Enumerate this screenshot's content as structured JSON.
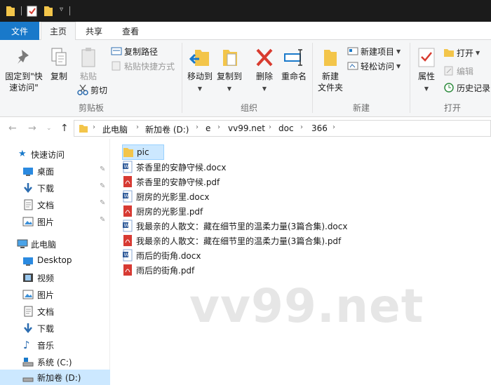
{
  "ribbon_tabs": {
    "file": "文件",
    "home": "主页",
    "share": "共享",
    "view": "查看"
  },
  "clipboard": {
    "pin_quick": "固定到\"快速访问\"",
    "pin_quick_l1": "固定到\"快",
    "pin_quick_l2": "速访问\"",
    "copy": "复制",
    "paste": "粘贴",
    "copy_path": "复制路径",
    "paste_shortcut": "粘贴快捷方式",
    "cut": "剪切",
    "label": "剪贴板"
  },
  "organize": {
    "move_to": "移动到",
    "copy_to": "复制到",
    "delete": "删除",
    "rename": "重命名",
    "label": "组织"
  },
  "new_group": {
    "new_folder_l1": "新建",
    "new_folder_l2": "文件夹",
    "new_item": "新建项目",
    "easy_access": "轻松访问",
    "label": "新建"
  },
  "open_group": {
    "properties": "属性",
    "open": "打开",
    "edit": "编辑",
    "history": "历史记录",
    "label": "打开"
  },
  "breadcrumb": [
    "此电脑",
    "新加卷 (D:)",
    "e",
    "vv99.net",
    "doc",
    "366"
  ],
  "nav_pane": {
    "quick_access": "快速访问",
    "pinned": [
      {
        "label": "桌面",
        "icon": "desktop-icon"
      },
      {
        "label": "下载",
        "icon": "download-icon"
      },
      {
        "label": "文档",
        "icon": "documents-icon"
      },
      {
        "label": "图片",
        "icon": "pictures-icon"
      }
    ],
    "this_pc": "此电脑",
    "pc_items": [
      {
        "label": "Desktop",
        "icon": "desktop-icon"
      },
      {
        "label": "视频",
        "icon": "video-icon"
      },
      {
        "label": "图片",
        "icon": "pictures-icon"
      },
      {
        "label": "文档",
        "icon": "documents-icon"
      },
      {
        "label": "下载",
        "icon": "download-icon"
      },
      {
        "label": "音乐",
        "icon": "music-icon"
      },
      {
        "label": "系统 (C:)",
        "icon": "drive-icon"
      },
      {
        "label": "新加卷 (D:)",
        "icon": "drive-icon"
      }
    ]
  },
  "files": [
    {
      "name": "pic",
      "type": "folder"
    },
    {
      "name": "茶香里的安静守候.docx",
      "type": "docx"
    },
    {
      "name": "茶香里的安静守候.pdf",
      "type": "pdf"
    },
    {
      "name": "厨房的光影里.docx",
      "type": "docx"
    },
    {
      "name": "厨房的光影里.pdf",
      "type": "pdf"
    },
    {
      "name": "我最亲的人散文：藏在细节里的温柔力量(3篇合集).docx",
      "type": "docx"
    },
    {
      "name": "我最亲的人散文：藏在细节里的温柔力量(3篇合集).pdf",
      "type": "pdf"
    },
    {
      "name": "雨后的街角.docx",
      "type": "docx"
    },
    {
      "name": "雨后的街角.pdf",
      "type": "pdf"
    }
  ],
  "watermark": "vv99.net",
  "colors": {
    "accent": "#1979ca",
    "selection": "#cce8ff",
    "folder": "#f3c54a",
    "pdf": "#d73a33",
    "word": "#2b5797"
  }
}
